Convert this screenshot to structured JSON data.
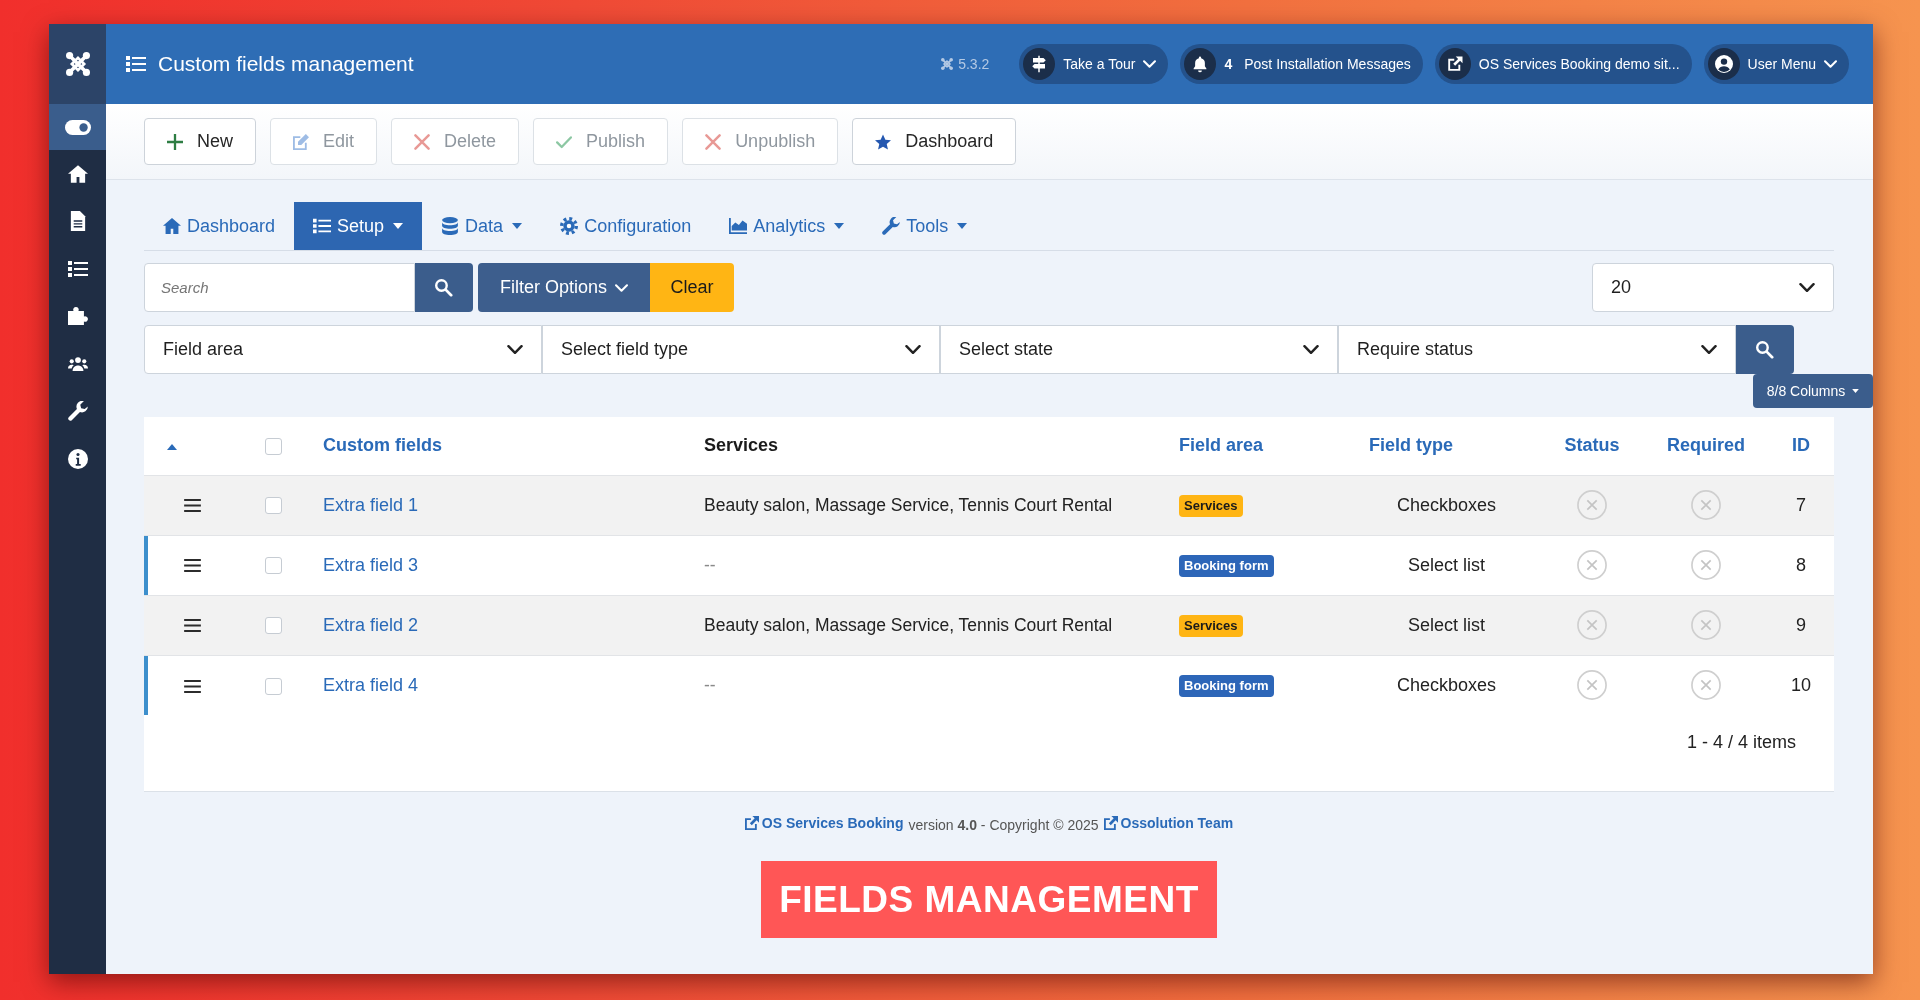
{
  "window": {
    "title": "Custom fields management"
  },
  "header": {
    "version": "5.3.2",
    "menus": [
      {
        "label": "Take a Tour",
        "has_menu": true
      },
      {
        "label": "Post Installation Messages",
        "count": "4",
        "has_menu": false
      },
      {
        "label": "OS Services Booking demo sit...",
        "has_menu": false
      },
      {
        "label": "User Menu",
        "has_menu": true
      }
    ]
  },
  "toolbar": {
    "buttons": [
      {
        "label": "New",
        "disabled": false
      },
      {
        "label": "Edit",
        "disabled": true
      },
      {
        "label": "Delete",
        "disabled": true
      },
      {
        "label": "Publish",
        "disabled": true
      },
      {
        "label": "Unpublish",
        "disabled": true
      },
      {
        "label": "Dashboard",
        "disabled": false
      }
    ]
  },
  "tabs": [
    {
      "label": "Dashboard",
      "selected": false,
      "has_menu": false
    },
    {
      "label": "Setup",
      "selected": true,
      "has_menu": true
    },
    {
      "label": "Data",
      "selected": false,
      "has_menu": true
    },
    {
      "label": "Configuration",
      "selected": false,
      "has_menu": false
    },
    {
      "label": "Analytics",
      "selected": false,
      "has_menu": true
    },
    {
      "label": "Tools",
      "selected": false,
      "has_menu": true
    }
  ],
  "search": {
    "placeholder": "Search",
    "filter_button": "Filter Options",
    "clear_button": "Clear",
    "limit": "20"
  },
  "filters": [
    {
      "value": "Field area"
    },
    {
      "value": "Select field type"
    },
    {
      "value": "Select state"
    },
    {
      "value": "Require status"
    }
  ],
  "columns_button": "8/8 Columns",
  "table": {
    "select_all": {
      "checked": false
    },
    "columns": [
      {
        "label": "Custom fields",
        "sortable": true
      },
      {
        "label": "Services",
        "sortable": false
      },
      {
        "label": "Field area",
        "sortable": true
      },
      {
        "label": "Field type",
        "sortable": true
      },
      {
        "label": "Status",
        "sortable": true
      },
      {
        "label": "Required",
        "sortable": true
      },
      {
        "label": "ID",
        "sortable": true
      }
    ],
    "rows": [
      {
        "checked": false,
        "name": "Extra field 1",
        "services": {
          "text": "Beauty salon, Massage Service, Tennis Court Rental",
          "muted": false
        },
        "area": {
          "label": "Services",
          "color": "#ffb514"
        },
        "type": "Checkboxes",
        "published": false,
        "required": false,
        "id": "7"
      },
      {
        "checked": false,
        "name": "Extra field 3",
        "services": {
          "text": "--",
          "muted": true
        },
        "area": {
          "label": "Booking form",
          "color": "#2d66b8"
        },
        "type": "Select list",
        "published": false,
        "required": false,
        "id": "8"
      },
      {
        "checked": false,
        "name": "Extra field 2",
        "services": {
          "text": "Beauty salon, Massage Service, Tennis Court Rental",
          "muted": false
        },
        "area": {
          "label": "Services",
          "color": "#ffb514"
        },
        "type": "Select list",
        "published": false,
        "required": false,
        "id": "9"
      },
      {
        "checked": false,
        "name": "Extra field 4",
        "services": {
          "text": "--",
          "muted": true
        },
        "area": {
          "label": "Booking form",
          "color": "#2d66b8"
        },
        "type": "Checkboxes",
        "published": false,
        "required": false,
        "id": "10"
      }
    ],
    "pagination": "1 - 4 / 4 items"
  },
  "footer": {
    "product_link": "OS Services Booking",
    "text": "version **4.0** - Copyright © 2025",
    "author_link": "Ossolution Team"
  },
  "banner": {
    "text": "FIELDS MANAGEMENT"
  }
}
